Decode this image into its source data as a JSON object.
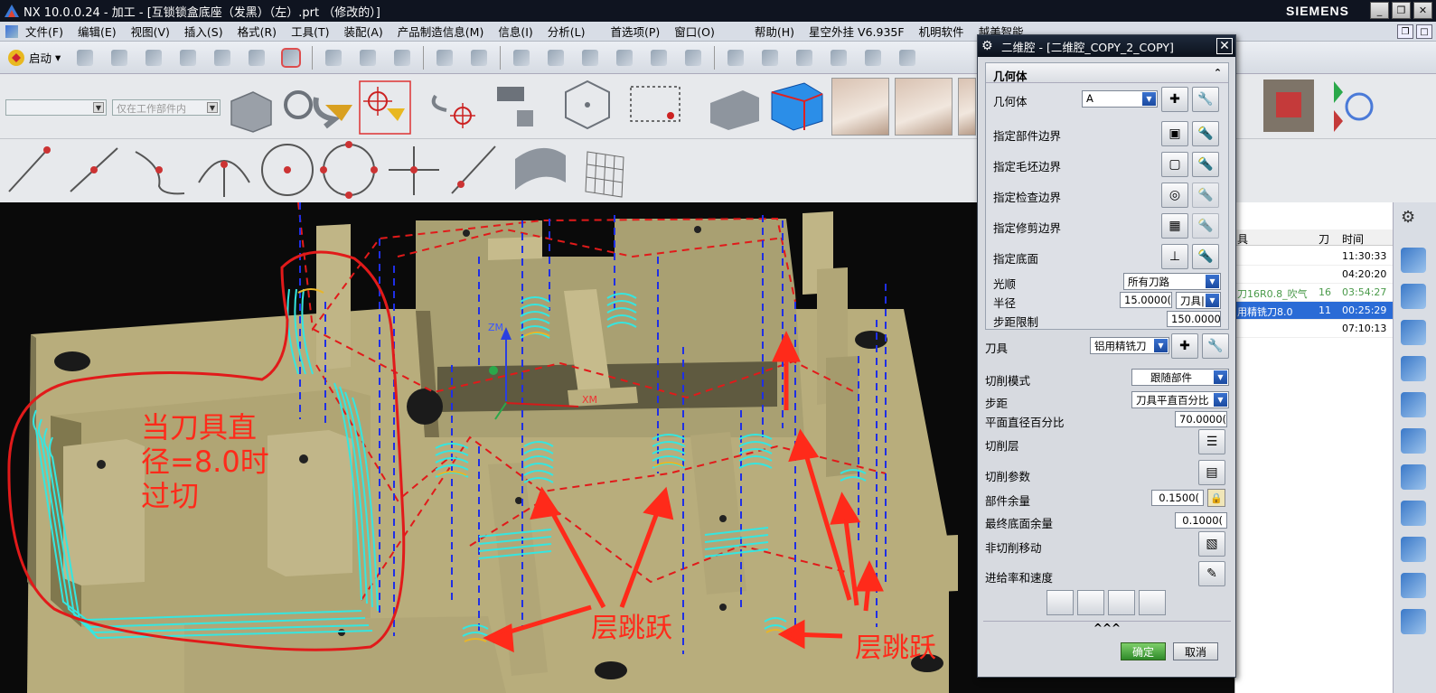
{
  "window": {
    "title": "NX 10.0.0.24 - 加工 - [互锁锁盒底座（发黑）（左）.prt （修改的）]",
    "brand": "SIEMENS",
    "buttons": [
      "_",
      "❐",
      "✕"
    ]
  },
  "menubar": {
    "items": [
      "文件(F)",
      "编辑(E)",
      "视图(V)",
      "插入(S)",
      "格式(R)",
      "工具(T)",
      "装配(A)",
      "产品制造信息(M)",
      "信息(I)",
      "分析(L)",
      "首选项(P)",
      "窗口(O)",
      "帮助(H)",
      "星空外挂 V6.935F",
      "机明软件",
      "越美智能"
    ]
  },
  "toolbar": {
    "start_label": "启动",
    "combo1": "",
    "combo2": "仅在工作部件内"
  },
  "viewport": {
    "annotation_main": "当刀具直\n径=8.0时\n过切",
    "annotation_jump_left": "层跳跃",
    "annotation_jump_right": "层跳跃",
    "axis_zm": "ZM",
    "axis_xm": "XM",
    "colors": {
      "part": "#b8ad7c",
      "toolpath_cyan": "#35e6e0",
      "toolpath_blue": "#1f2fe6",
      "rapid_red": "#e11a1a",
      "annotation": "#ff2a1a"
    }
  },
  "navigator": {
    "columns": [
      "具",
      "刀",
      "时间"
    ],
    "rows": [
      {
        "name": "",
        "tool": "",
        "time": "11:30:33",
        "state": "normal"
      },
      {
        "name": "",
        "tool": "",
        "time": "04:20:20",
        "state": "normal"
      },
      {
        "name": "刀16R0.8_吹气",
        "tool": "16",
        "time": "03:54:27",
        "state": "green"
      },
      {
        "name": "用精铣刀8.0",
        "tool": "11",
        "time": "00:25:29",
        "state": "selected"
      },
      {
        "name": "",
        "tool": "",
        "time": "07:10:13",
        "state": "normal"
      }
    ]
  },
  "dialog": {
    "title": "二维腔 - [二维腔_COPY_2_COPY]",
    "close_label": "✕",
    "geometry_group": {
      "header": "几何体",
      "geometry_label": "几何体",
      "geometry_value": "A",
      "part_boundary": "指定部件边界",
      "blank_boundary": "指定毛坯边界",
      "check_boundary": "指定检查边界",
      "trim_boundary": "指定修剪边界",
      "floor": "指定底面",
      "smooth_label": "光顺",
      "smooth_value": "所有刀路",
      "radius_label": "半径",
      "radius_value": "15.0000(",
      "radius_unit": "刀具|",
      "stepover_limit_label": "步距限制",
      "stepover_limit_value": "150.0000("
    },
    "tool_label": "刀具",
    "tool_value": "铝用精铣刀",
    "cut_pattern_label": "切削模式",
    "cut_pattern_value": "跟随部件",
    "stepover_label": "步距",
    "stepover_value": "刀具平直百分比",
    "flat_percent_label": "平面直径百分比",
    "flat_percent_value": "70.0000(",
    "cut_levels_label": "切削层",
    "cut_params_label": "切削参数",
    "part_stock_label": "部件余量",
    "part_stock_value": "0.1500(",
    "floor_stock_label": "最终底面余量",
    "floor_stock_value": "0.1000(",
    "non_cut_label": "非切削移动",
    "feeds_label": "进给率和速度",
    "expand_label": "^^^",
    "ok_label": "确定",
    "cancel_label": "取消"
  }
}
